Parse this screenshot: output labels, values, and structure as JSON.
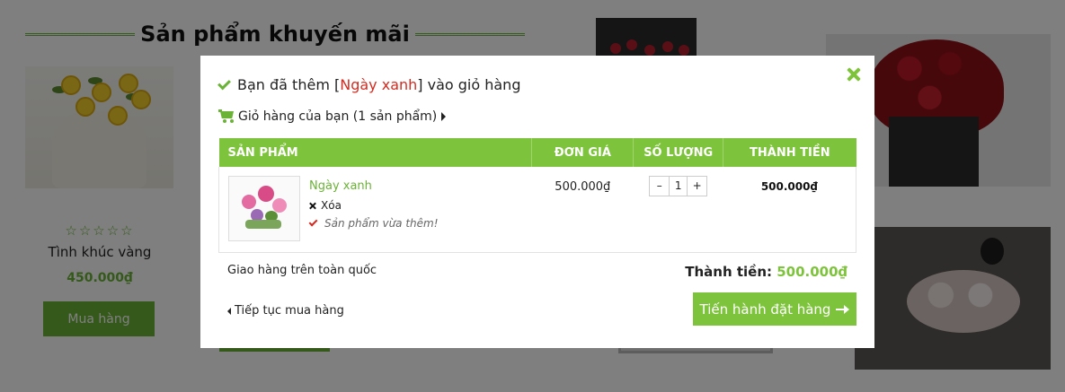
{
  "background": {
    "section_title": "Sản phẩm khuyến mãi",
    "product": {
      "rating_stars": "☆☆☆☆☆",
      "name": "Tình khúc vàng",
      "price": "450.000₫",
      "buy_label": "Mua hàng"
    }
  },
  "modal": {
    "added_prefix": "Bạn đã thêm [",
    "added_product": "Ngày xanh",
    "added_suffix": "] vào giỏ hàng",
    "cart_summary": "Giỏ hàng của bạn (1 sản phẩm)",
    "table": {
      "headers": [
        "SẢN PHẨM",
        "ĐƠN GIÁ",
        "SỐ LƯỢNG",
        "THÀNH TIỀN"
      ],
      "items": [
        {
          "name": "Ngày xanh",
          "remove_label": "Xóa",
          "note": "Sản phẩm vừa thêm!",
          "unit_price": "500.000₫",
          "qty_minus": "–",
          "quantity": "1",
          "qty_plus": "+",
          "line_total": "500.000₫"
        }
      ]
    },
    "shipping_note": "Giao hàng trên toàn quốc",
    "total_label": "Thành tiền: ",
    "total_value": "500.000₫",
    "continue_label": "Tiếp tục mua hàng",
    "checkout_label": "Tiến hành đặt hàng"
  },
  "colors": {
    "accent_green": "#7dc33b",
    "dark_green": "#6ab336",
    "highlight_red": "#d42b20",
    "overlay": "rgba(0,0,0,0.5)"
  },
  "icons": [
    "check-icon",
    "close-icon",
    "cart-icon",
    "caret-right-icon",
    "remove-x-icon",
    "check-red-icon",
    "caret-left-icon",
    "arrow-right-icon"
  ]
}
